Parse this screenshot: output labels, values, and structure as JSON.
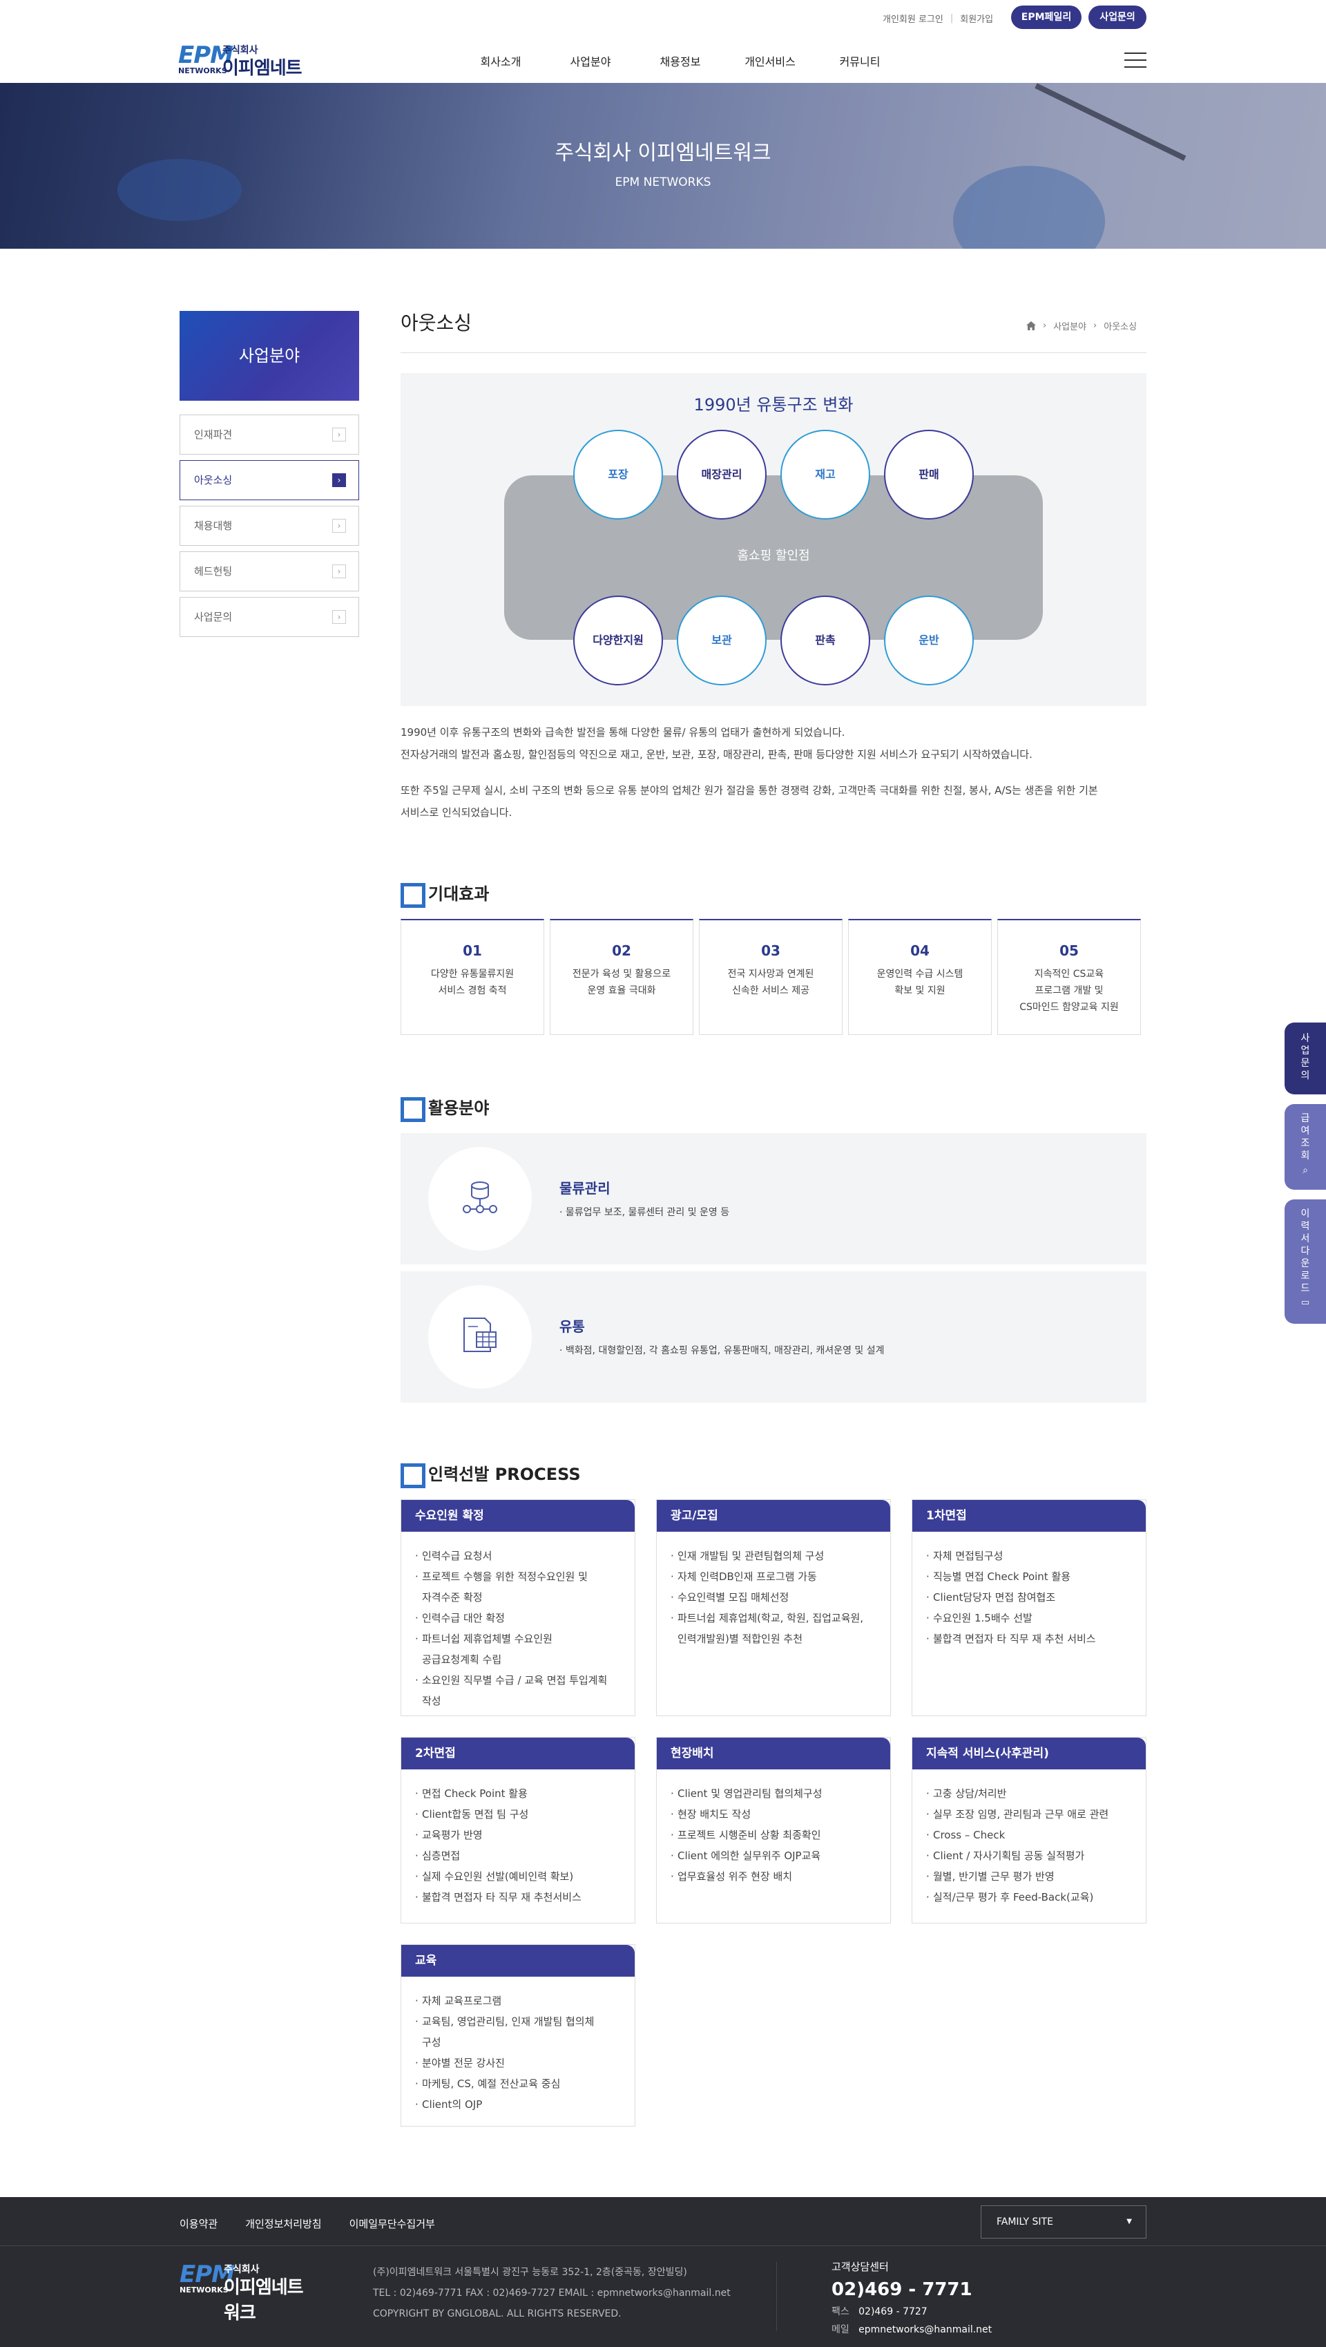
{
  "header": {
    "login": "개인회원 로그인",
    "join": "회원가입",
    "btn_mall": "EPM페일리",
    "btn_inquiry": "사업문의",
    "logo": {
      "epm": "EPM",
      "networks": "NETWORKS",
      "sub": "주식회사",
      "name": "이피엠네트워크"
    },
    "nav": [
      "회사소개",
      "사업분야",
      "채용정보",
      "개인서비스",
      "커뮤니티"
    ]
  },
  "banner": {
    "title": "주식회사 이피엠네트워크",
    "subtitle": "EPM NETWORKS"
  },
  "lnb": {
    "title": "사업분야",
    "items": [
      "인재파견",
      "아웃소싱",
      "채용대행",
      "헤드헌팅",
      "사업문의"
    ],
    "active_index": 1
  },
  "content": {
    "title": "아웃소싱",
    "breadcrumb": [
      "사업분야",
      "아웃소싱"
    ]
  },
  "diagram": {
    "title": "1990년 유통구조 변화",
    "center": "홈쇼핑 할인점",
    "top": [
      "포장",
      "매장관리",
      "재고",
      "판매"
    ],
    "bottom": [
      "다양한지원",
      "보관",
      "판촉",
      "운반"
    ]
  },
  "intro": {
    "p1_l1": "1990년 이후 유통구조의 변화와 급속한 발전을 통해 다양한 물류/ 유통의 업태가 출현하게 되었습니다.",
    "p1_l2": "전자상거래의 발전과 홈쇼핑, 할인점등의 약진으로 재고, 운반, 보관, 포장, 매장관리, 판촉, 판매 등다양한 지원 서비스가 요구되기 시작하였습니다.",
    "p2_l1": "또한 주5일 근무제 실시, 소비 구조의 변화 등으로 유통 분야의 업체간 원가 절감을 통한 경쟁력 강화, 고객만족 극대화를 위한 친절, 봉사, A/S는 생존을 위한 기본",
    "p2_l2": "서비스로 인식되었습니다."
  },
  "effects": {
    "title": "기대효과",
    "cards": [
      {
        "num": "01",
        "text": "다양한 유통물류지원\n서비스 경험 축적"
      },
      {
        "num": "02",
        "text": "전문가 육성 및 활용으로\n운영 효율 극대화"
      },
      {
        "num": "03",
        "text": "전국 지사망과 연계된\n신속한 서비스 제공"
      },
      {
        "num": "04",
        "text": "운영인력 수급 시스템\n확보 및 지원"
      },
      {
        "num": "05",
        "text": "지속적인 CS교육\n프로그램 개발 및\nCS마인드 함양교육 지원"
      }
    ]
  },
  "fields": {
    "title": "활용분야",
    "items": [
      {
        "title": "물류관리",
        "desc": "물류업무 보조, 물류센터 관리 및 운영 등",
        "icon": "logistics-icon"
      },
      {
        "title": "유통",
        "desc": "백화점, 대형할인점, 각 홈쇼핑 유통업, 유통판매직, 매장관리, 캐셔운영 및 설계",
        "icon": "distribution-icon"
      }
    ]
  },
  "process": {
    "title": "인력선발 PROCESS",
    "boxes": [
      {
        "title": "수요인원 확정",
        "items": [
          "인력수급 요청서",
          "프로젝트 수행을 위한 적정수요인원 및\n자격수준 확정",
          "인력수급 대안 확정",
          "파트너쉽 제휴업체별 수요인원\n공급요청계획 수립",
          "소요인원 직무별 수급 / 교육 면접 투입계획\n작성"
        ]
      },
      {
        "title": "광고/모집",
        "items": [
          "인재 개발팀 및 관련팀협의체 구성",
          "자체 인력DB인재 프로그램 가동",
          "수요인력별 모집 매체선정",
          "파트너쉽 제휴업체(학교, 학원, 집업교육원,\n인력개발원)별 적합인원 추천"
        ]
      },
      {
        "title": "1차면접",
        "items": [
          "자체 면접팀구성",
          "직능별 면접 Check Point 활용",
          "Client담당자 면접 참여협조",
          "수요인원 1.5배수 선발",
          "불합격 면접자 타 직무 재 추천 서비스"
        ]
      },
      {
        "title": "2차면접",
        "items": [
          "면접 Check Point 활용",
          "Client합동 면접 팀 구성",
          "교육평가 반영",
          "심층면접",
          "실제 수요인원 선발(예비인력 확보)",
          "불합격 면접자 타 직무 재 추천서비스"
        ]
      },
      {
        "title": "현장배치",
        "items": [
          "Client 및 영업관리팀 협의체구성",
          "현장 배치도 작성",
          "프로젝트 시행준비 상황 최종확인",
          "Client 에의한 실무위주 OJP교육",
          "업무효율성 위주 현장 배치"
        ]
      },
      {
        "title": "지속적 서비스(사후관리)",
        "items": [
          "고충 상담/처리반",
          "실무 조장 임명, 관리팀과 근무 애로 관련",
          "Cross – Check",
          "Client / 자사기획팀 공동 실적평가",
          "월별, 반기별 근무 평가 반영",
          "실적/근무 평가 후 Feed-Back(교육)"
        ]
      },
      {
        "title": "교육",
        "items": [
          "자체 교육프로그램",
          "교육팀, 영업관리팀, 인재 개발팀 협의체\n구성",
          "분야별 전문 강사진",
          "마케팅, CS, 예절 전산교육 중심",
          "Client의 OJP"
        ]
      }
    ]
  },
  "quick": {
    "inquiry": "사업문의",
    "pay": "급여조회",
    "resume": "이력서다운로드"
  },
  "footer": {
    "links": [
      "이용약관",
      "개인정보처리방침",
      "이메일무단수집거부"
    ],
    "family": "FAMILY SITE",
    "addr": "(주)이피엠네트워크 서울특별시 광진구 능동로 352-1, 2층(중곡동, 장안빌딩)",
    "contact": "TEL : 02)469-7771 FAX : 02)469-7727 EMAIL : epmnetworks@hanmail.net",
    "copy": "COPYRIGHT BY GNGLOBAL. ALL RIGHTS RESERVED.",
    "cs_title": "고객상담센터",
    "tel": "02)469 - 7771",
    "fax_label": "팩스",
    "fax": "02)469 - 7727",
    "mail_label": "메일",
    "mail": "epmnetworks@hanmail.net"
  }
}
